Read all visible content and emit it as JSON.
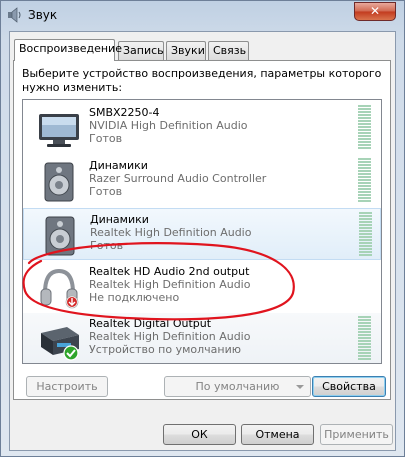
{
  "window": {
    "title": "Звук",
    "close_glyph": "✕"
  },
  "tabs": [
    {
      "label": "Воспроизведение",
      "active": true
    },
    {
      "label": "Запись"
    },
    {
      "label": "Звуки"
    },
    {
      "label": "Связь"
    }
  ],
  "instructions": "Выберите устройство воспроизведения, параметры которого нужно изменить:",
  "devices": [
    {
      "name": "SMBX2250-4",
      "driver": "NVIDIA High Definition Audio",
      "status": "Готов",
      "icon": "monitor-icon"
    },
    {
      "name": "Динамики",
      "driver": "Razer Surround Audio Controller",
      "status": "Готов",
      "icon": "speaker-icon"
    },
    {
      "name": "Динамики",
      "driver": "Realtek High Definition Audio",
      "status": "Готов",
      "icon": "speaker-icon",
      "selected": true
    },
    {
      "name": "Realtek HD Audio 2nd output",
      "driver": "Realtek High Definition Audio",
      "status": "Не подключено",
      "icon": "headphones-icon",
      "badge": "red-down-arrow"
    },
    {
      "name": "Realtek Digital Output",
      "driver": "Realtek High Definition Audio",
      "status": "Устройство по умолчанию",
      "icon": "digital-output-icon",
      "badge": "green-check"
    }
  ],
  "buttons": {
    "configure": "Настроить",
    "default": "По умолчанию",
    "properties": "Свойства",
    "ok": "ОК",
    "cancel": "Отмена",
    "apply": "Применить"
  },
  "colors": {
    "annotation": "#e0141e",
    "meter": "#a7d3b7",
    "selection": "#e1eef9"
  }
}
